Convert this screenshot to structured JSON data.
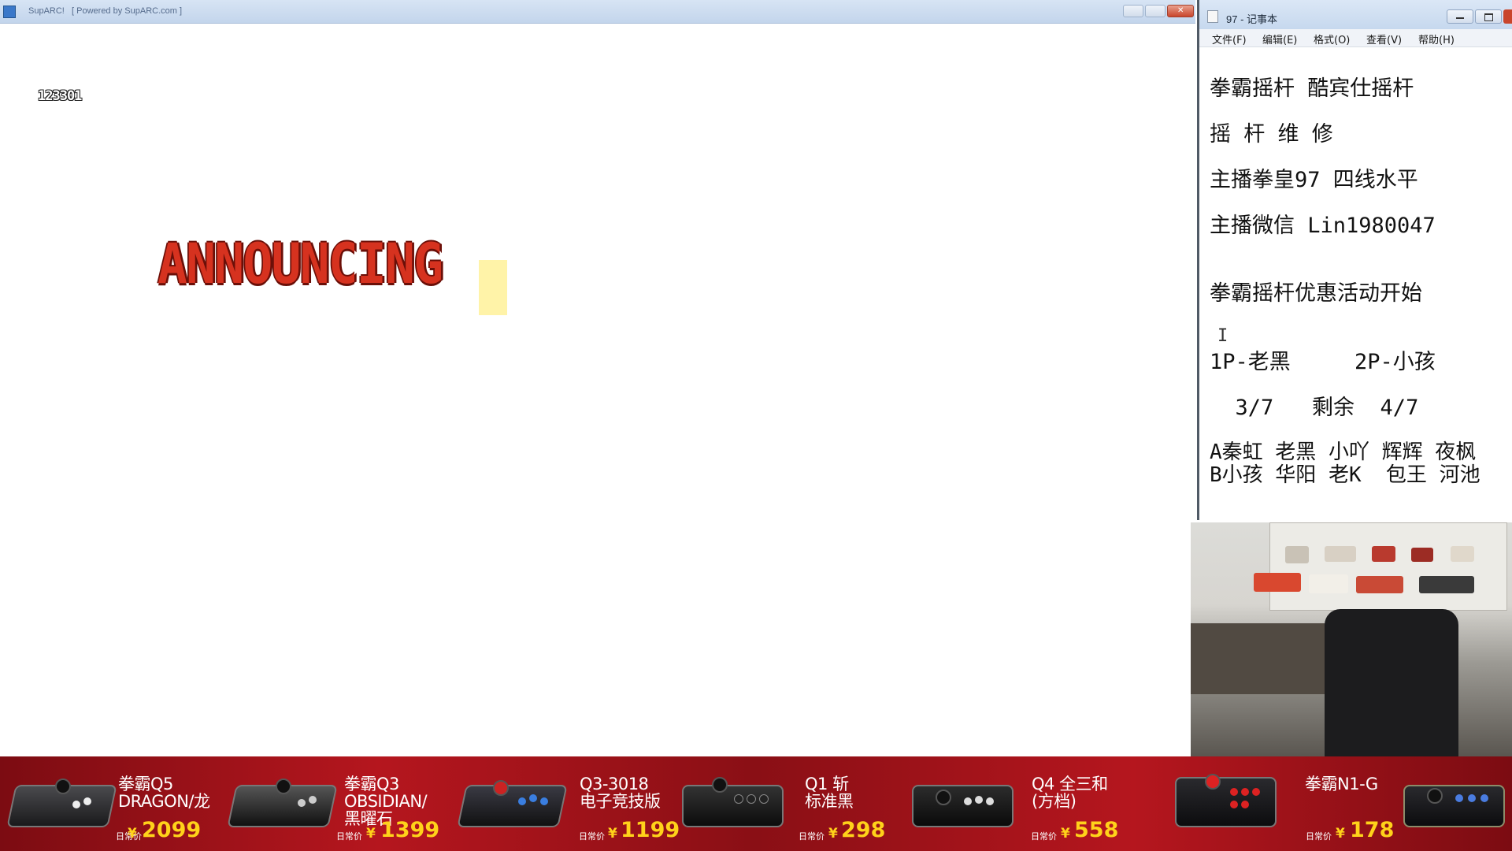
{
  "emulator": {
    "title": "SupARC!   [ Powered by SupARC.com ]",
    "hiscore": "123301",
    "game_text": "ANNOUNCING"
  },
  "notepad": {
    "title": "97 - 记事本",
    "menu": [
      "文件(F)",
      "编辑(E)",
      "格式(O)",
      "查看(V)",
      "帮助(H)"
    ],
    "lines": [
      "拳霸摇杆 酷宾仕摇杆",
      "摇 杆 维 修",
      "主播拳皇97 四线水平",
      "主播微信 Lin1980047",
      "拳霸摇杆优惠活动开始",
      "1P-老黑     2P-小孩",
      "  3/7   剩余  4/7",
      "A秦虹 老黑 小吖 辉辉 夜枫",
      "B小孩 华阳 老K  包王 河池"
    ]
  },
  "banner": {
    "price_label": "日常价",
    "currency": "¥",
    "products": [
      {
        "name": "拳霸Q5\nDRAGON/龙",
        "price": "2099"
      },
      {
        "name": "拳霸Q3\nOBSIDIAN/\n黑曜石",
        "price": "1399"
      },
      {
        "name": "Q3-3018\n电子竞技版",
        "price": "1199"
      },
      {
        "name": "Q1 斩\n标准黑",
        "price": "298"
      },
      {
        "name": "Q4 全三和\n(方档)",
        "price": "558"
      },
      {
        "name": "拳霸N1-G",
        "price": "178"
      }
    ]
  },
  "colors": {
    "banner_bg": "#9c1219",
    "price": "#ffd21a",
    "game_text": "#d6321f"
  }
}
